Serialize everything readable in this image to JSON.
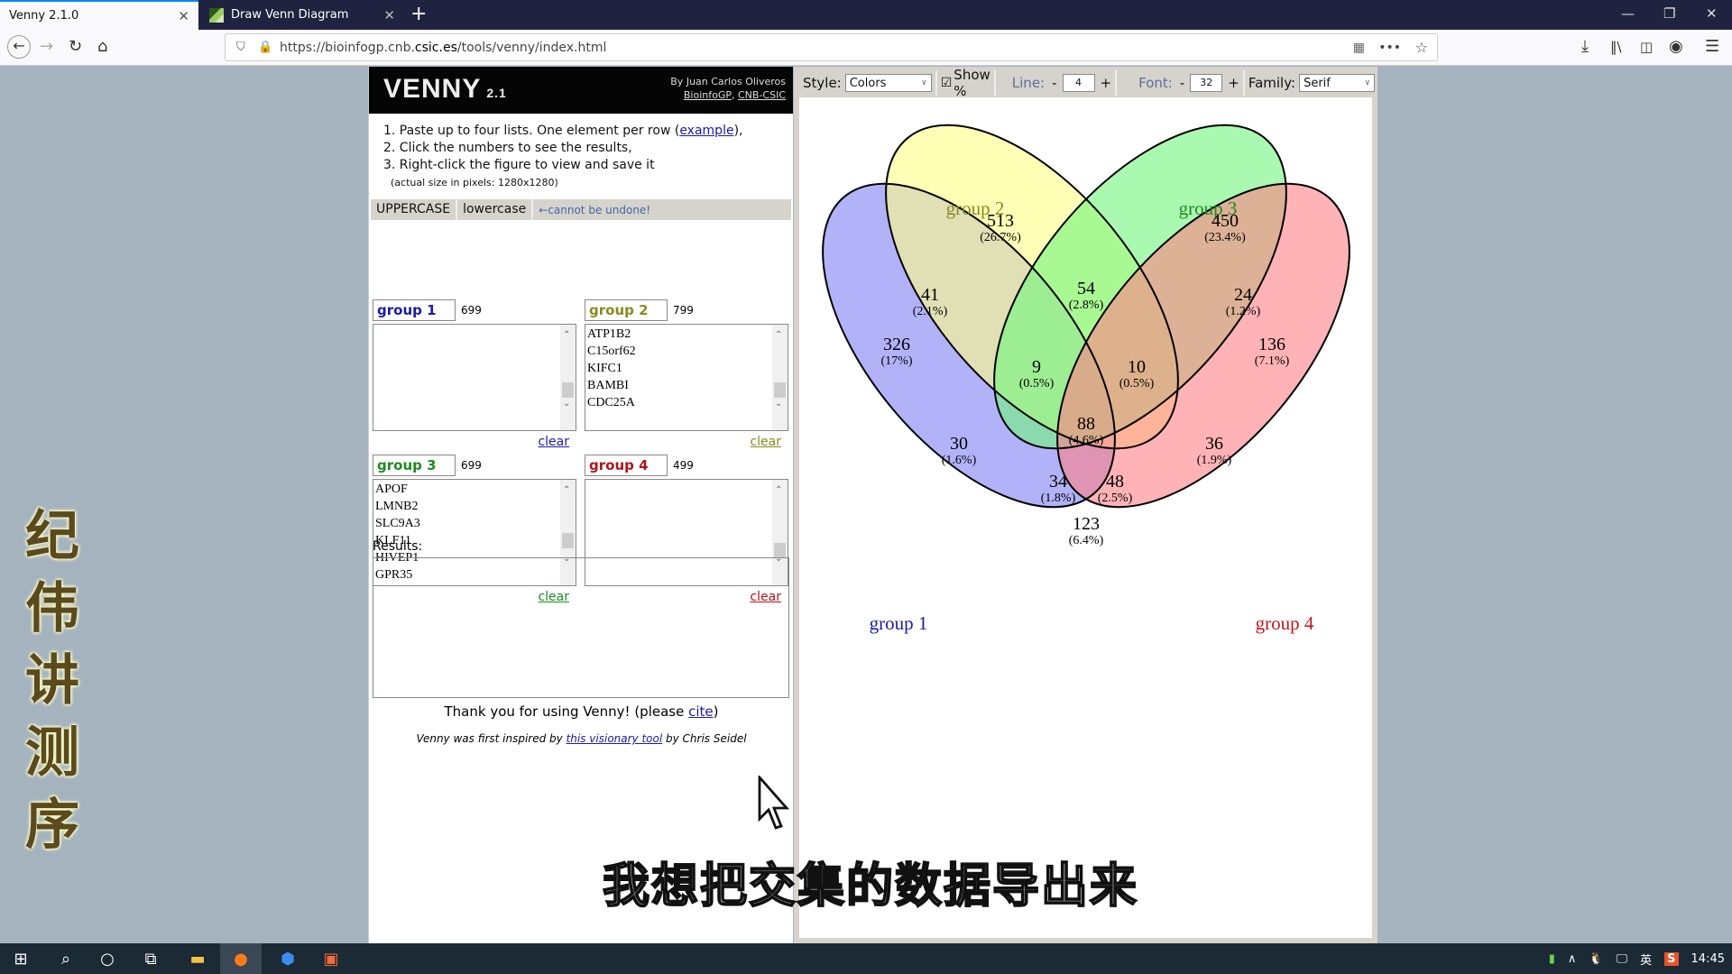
{
  "browser": {
    "tabs": [
      {
        "title": "Venny 2.1.0",
        "active": true
      },
      {
        "title": "Draw Venn Diagram",
        "active": false
      }
    ],
    "url_prefix": "https://bioinfogp.cnb.",
    "url_domain": "csic.es",
    "url_suffix": "/tools/venny/index.html"
  },
  "venny": {
    "title": "VENNY",
    "version": "2.1",
    "author": "By Juan Carlos Oliveros",
    "affil1": "BioinfoGP",
    "affil2": "CNB-CSIC",
    "instructions": {
      "step1_pre": "1. Paste up to four lists. One element per row (",
      "step1_link": "example",
      "step1_post": "),",
      "step2": "2. Click the numbers to see the results,",
      "step3": "3. Right-click the figure to view and save it",
      "note": "(actual size in pixels: 1280x1280)"
    },
    "case": {
      "upper": "UPPERCASE",
      "lower": "lowercase",
      "warning": "←cannot be undone!"
    },
    "groups": [
      {
        "name": "group 1",
        "count": "699",
        "color": "#1a1aa6",
        "items": [],
        "clear": "clear",
        "thumb": 0.55
      },
      {
        "name": "group 2",
        "count": "799",
        "color": "#8a8a1f",
        "items": [
          "ATP1B2",
          "C15orf62",
          "KIFC1",
          "BAMBI",
          "CDC25A"
        ],
        "clear": "clear",
        "thumb": 0.55
      },
      {
        "name": "group 3",
        "count": "699",
        "color": "#1f8a1f",
        "items": [
          "APOF",
          "LMNB2",
          "SLC9A3",
          "KLF11",
          "HIVEP1",
          "GPR35"
        ],
        "clear": "clear",
        "thumb": 0.5
      },
      {
        "name": "group 4",
        "count": "499",
        "color": "#b0141a",
        "items": [],
        "clear": "clear",
        "thumb": 0.6
      }
    ],
    "results_label": "Results:",
    "thanks_pre": "Thank you for using Venny!  (please ",
    "thanks_link": "cite",
    "thanks_post": ")",
    "inspired_pre": "Venny was first inspired by ",
    "inspired_link": "this visionary tool",
    "inspired_post": " by Chris Seidel"
  },
  "options": {
    "style_label": "Style:",
    "style_value": "Colors",
    "show_pct_label": "Show %",
    "show_pct_checked": true,
    "line_label": "Line:",
    "line_value": "4",
    "font_label": "Font:",
    "font_value": "32",
    "family_label": "Family:",
    "family_value": "Serif",
    "minus": "-",
    "plus": "+"
  },
  "chart_data": {
    "type": "venn",
    "sets": [
      {
        "name": "group 1",
        "color": "#1a1aa6"
      },
      {
        "name": "group 2",
        "color": "#8a8a1f"
      },
      {
        "name": "group 3",
        "color": "#1f8a1f"
      },
      {
        "name": "group 4",
        "color": "#c4141a"
      }
    ],
    "regions": [
      {
        "sets": [
          "group 1"
        ],
        "count": 326,
        "pct": "17%"
      },
      {
        "sets": [
          "group 2"
        ],
        "count": 513,
        "pct": "26.7%"
      },
      {
        "sets": [
          "group 3"
        ],
        "count": 450,
        "pct": "23.4%"
      },
      {
        "sets": [
          "group 4"
        ],
        "count": 136,
        "pct": "7.1%"
      },
      {
        "sets": [
          "group 1",
          "group 2"
        ],
        "count": 41,
        "pct": "2.1%"
      },
      {
        "sets": [
          "group 2",
          "group 3"
        ],
        "count": 54,
        "pct": "2.8%"
      },
      {
        "sets": [
          "group 3",
          "group 4"
        ],
        "count": 24,
        "pct": "1.2%"
      },
      {
        "sets": [
          "group 1",
          "group 2",
          "group 3"
        ],
        "count": 9,
        "pct": "0.5%"
      },
      {
        "sets": [
          "group 2",
          "group 3",
          "group 4"
        ],
        "count": 10,
        "pct": "0.5%"
      },
      {
        "sets": [
          "group 1",
          "group 3"
        ],
        "count": 30,
        "pct": "1.6%"
      },
      {
        "sets": [
          "group 2",
          "group 4"
        ],
        "count": 36,
        "pct": "1.9%"
      },
      {
        "sets": [
          "group 1",
          "group 2",
          "group 3",
          "group 4"
        ],
        "count": 88,
        "pct": "4.6%"
      },
      {
        "sets": [
          "group 1",
          "group 3",
          "group 4"
        ],
        "count": 34,
        "pct": "1.8%"
      },
      {
        "sets": [
          "group 1",
          "group 2",
          "group 4"
        ],
        "count": 48,
        "pct": "2.5%"
      },
      {
        "sets": [
          "group 1",
          "group 4"
        ],
        "count": 123,
        "pct": "6.4%"
      }
    ]
  },
  "overlay": {
    "side_text": [
      "纪",
      "伟",
      "讲",
      "测",
      "序"
    ],
    "subtitle": "我想把交集的数据导出来"
  },
  "taskbar": {
    "clock": "14:45",
    "ime": "英"
  }
}
